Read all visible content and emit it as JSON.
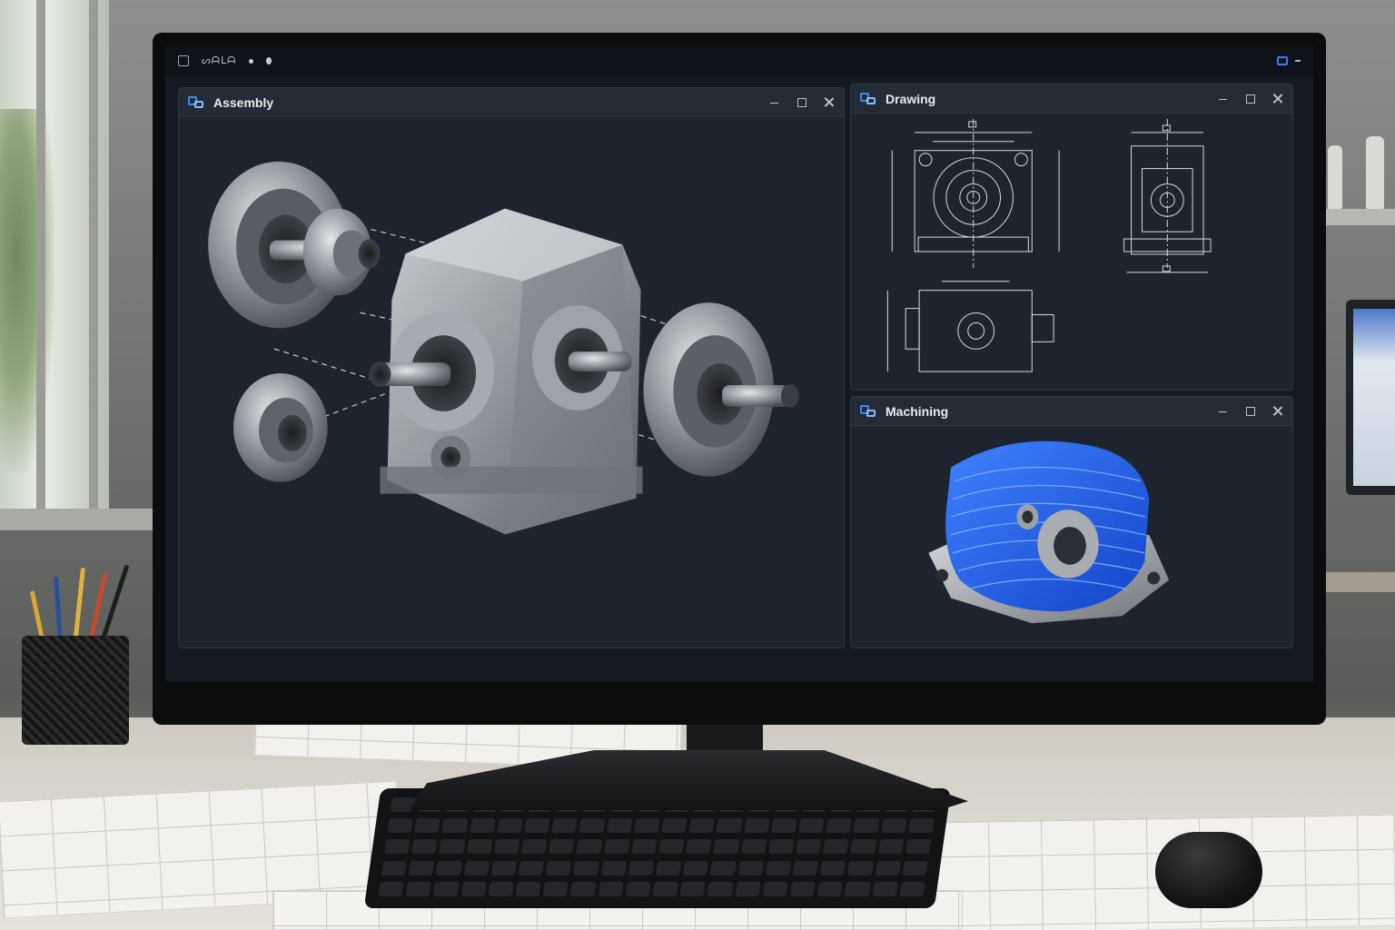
{
  "taskbar": {
    "app_text": "ᔕᗩᒪᗩ"
  },
  "windows": {
    "assembly": {
      "title": "Assembly"
    },
    "drawing": {
      "title": "Drawing"
    },
    "machining": {
      "title": "Machining"
    }
  },
  "icons": {
    "window_app": "cad-window-icon",
    "minimize": "minimize-icon",
    "maximize": "maximize-icon",
    "close": "close-icon"
  },
  "colors": {
    "accent_blue": "#3d8cf0",
    "toolpath_blue": "#1f5fe8",
    "window_bg": "#1b222c",
    "titlebar_bg": "#232b37"
  }
}
